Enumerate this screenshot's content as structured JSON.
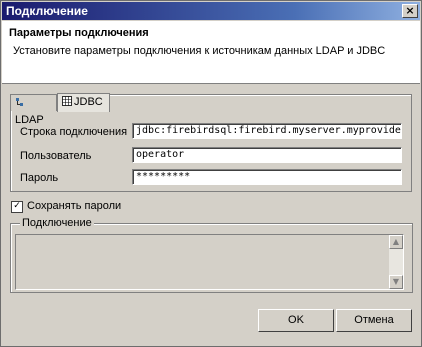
{
  "window": {
    "title": "Подключение",
    "close_label": "×"
  },
  "header": {
    "title": "Параметры подключения",
    "subtitle": "Установите параметры подключения к источникам данных LDAP и JDBC"
  },
  "tabs": [
    {
      "label": "LDAP",
      "icon": "ldap-icon"
    },
    {
      "label": "JDBC",
      "icon": "table-icon"
    }
  ],
  "form": {
    "connection_label": "Строка подключения",
    "connection_value": "jdbc:firebirdsql:firebird.myserver.myprovider.ru:billing",
    "user_label": "Пользователь",
    "user_value": "operator",
    "password_label": "Пароль",
    "password_value": "*********"
  },
  "save_passwords": {
    "label": "Сохранять пароли",
    "checked": true,
    "mark": "✓"
  },
  "connection_group": {
    "legend": "Подключение"
  },
  "scrollbar": {
    "up": "▲",
    "down": "▼"
  },
  "buttons": {
    "ok": "OK",
    "cancel": "Отмена"
  }
}
